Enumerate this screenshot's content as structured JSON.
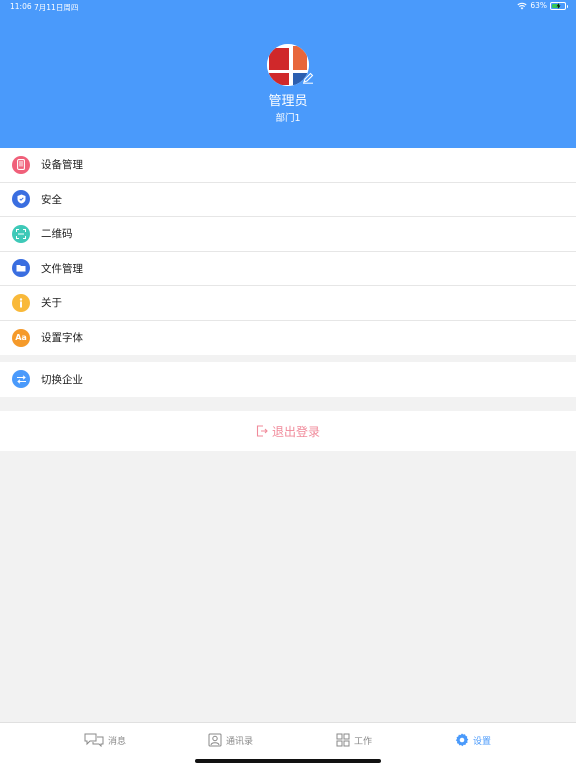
{
  "status_bar": {
    "time": "11:06",
    "date": "7月11日周四",
    "battery_percent": "63%",
    "battery_level": 0.63
  },
  "profile": {
    "name": "管理员",
    "department": "部门1"
  },
  "menu": {
    "group1": [
      {
        "label": "设备管理",
        "icon": "phone-icon",
        "color": "#f0607a"
      },
      {
        "label": "安全",
        "icon": "shield-icon",
        "color": "#3a6ee0"
      },
      {
        "label": "二维码",
        "icon": "qr-scan-icon",
        "color": "#3ec9b8"
      },
      {
        "label": "文件管理",
        "icon": "folder-icon",
        "color": "#3a6ee0"
      },
      {
        "label": "关于",
        "icon": "info-icon",
        "color": "#f9b93a"
      },
      {
        "label": "设置字体",
        "icon": "font-icon",
        "icon_text": "Aa",
        "color": "#f59a2a"
      }
    ],
    "group2": [
      {
        "label": "切换企业",
        "icon": "switch-icon",
        "color": "#4a9afb"
      }
    ]
  },
  "logout": {
    "label": "退出登录",
    "color": "#f08a9a"
  },
  "tabbar": {
    "tabs": [
      {
        "label": "消息",
        "icon": "message-icon",
        "active": false
      },
      {
        "label": "通讯录",
        "icon": "contacts-icon",
        "active": false
      },
      {
        "label": "工作",
        "icon": "grid-icon",
        "active": false
      },
      {
        "label": "设置",
        "icon": "gear-icon",
        "active": true
      }
    ]
  },
  "colors": {
    "header_bg": "#4a9afb",
    "page_bg": "#f2f2f2",
    "accent": "#4a9afb"
  }
}
